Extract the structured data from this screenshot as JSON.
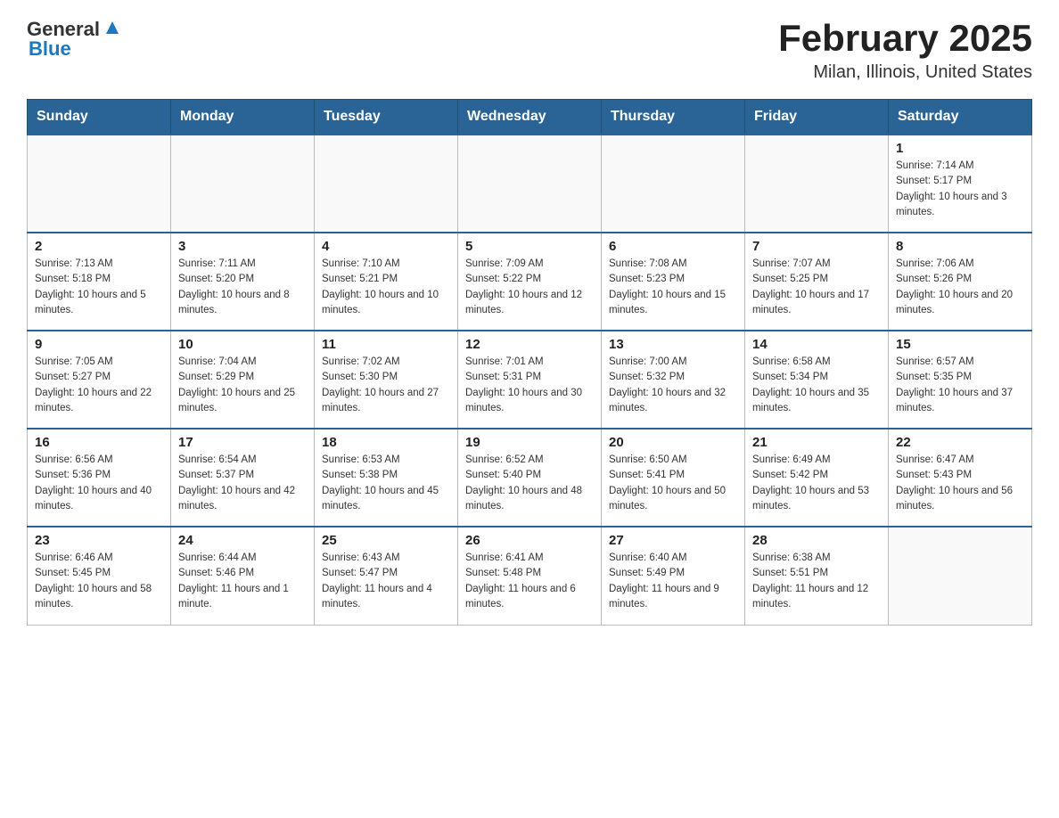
{
  "header": {
    "logo_general": "General",
    "logo_blue": "Blue",
    "month_title": "February 2025",
    "location": "Milan, Illinois, United States"
  },
  "days_of_week": [
    "Sunday",
    "Monday",
    "Tuesday",
    "Wednesday",
    "Thursday",
    "Friday",
    "Saturday"
  ],
  "weeks": [
    [
      {
        "day": "",
        "info": ""
      },
      {
        "day": "",
        "info": ""
      },
      {
        "day": "",
        "info": ""
      },
      {
        "day": "",
        "info": ""
      },
      {
        "day": "",
        "info": ""
      },
      {
        "day": "",
        "info": ""
      },
      {
        "day": "1",
        "info": "Sunrise: 7:14 AM\nSunset: 5:17 PM\nDaylight: 10 hours and 3 minutes."
      }
    ],
    [
      {
        "day": "2",
        "info": "Sunrise: 7:13 AM\nSunset: 5:18 PM\nDaylight: 10 hours and 5 minutes."
      },
      {
        "day": "3",
        "info": "Sunrise: 7:11 AM\nSunset: 5:20 PM\nDaylight: 10 hours and 8 minutes."
      },
      {
        "day": "4",
        "info": "Sunrise: 7:10 AM\nSunset: 5:21 PM\nDaylight: 10 hours and 10 minutes."
      },
      {
        "day": "5",
        "info": "Sunrise: 7:09 AM\nSunset: 5:22 PM\nDaylight: 10 hours and 12 minutes."
      },
      {
        "day": "6",
        "info": "Sunrise: 7:08 AM\nSunset: 5:23 PM\nDaylight: 10 hours and 15 minutes."
      },
      {
        "day": "7",
        "info": "Sunrise: 7:07 AM\nSunset: 5:25 PM\nDaylight: 10 hours and 17 minutes."
      },
      {
        "day": "8",
        "info": "Sunrise: 7:06 AM\nSunset: 5:26 PM\nDaylight: 10 hours and 20 minutes."
      }
    ],
    [
      {
        "day": "9",
        "info": "Sunrise: 7:05 AM\nSunset: 5:27 PM\nDaylight: 10 hours and 22 minutes."
      },
      {
        "day": "10",
        "info": "Sunrise: 7:04 AM\nSunset: 5:29 PM\nDaylight: 10 hours and 25 minutes."
      },
      {
        "day": "11",
        "info": "Sunrise: 7:02 AM\nSunset: 5:30 PM\nDaylight: 10 hours and 27 minutes."
      },
      {
        "day": "12",
        "info": "Sunrise: 7:01 AM\nSunset: 5:31 PM\nDaylight: 10 hours and 30 minutes."
      },
      {
        "day": "13",
        "info": "Sunrise: 7:00 AM\nSunset: 5:32 PM\nDaylight: 10 hours and 32 minutes."
      },
      {
        "day": "14",
        "info": "Sunrise: 6:58 AM\nSunset: 5:34 PM\nDaylight: 10 hours and 35 minutes."
      },
      {
        "day": "15",
        "info": "Sunrise: 6:57 AM\nSunset: 5:35 PM\nDaylight: 10 hours and 37 minutes."
      }
    ],
    [
      {
        "day": "16",
        "info": "Sunrise: 6:56 AM\nSunset: 5:36 PM\nDaylight: 10 hours and 40 minutes."
      },
      {
        "day": "17",
        "info": "Sunrise: 6:54 AM\nSunset: 5:37 PM\nDaylight: 10 hours and 42 minutes."
      },
      {
        "day": "18",
        "info": "Sunrise: 6:53 AM\nSunset: 5:38 PM\nDaylight: 10 hours and 45 minutes."
      },
      {
        "day": "19",
        "info": "Sunrise: 6:52 AM\nSunset: 5:40 PM\nDaylight: 10 hours and 48 minutes."
      },
      {
        "day": "20",
        "info": "Sunrise: 6:50 AM\nSunset: 5:41 PM\nDaylight: 10 hours and 50 minutes."
      },
      {
        "day": "21",
        "info": "Sunrise: 6:49 AM\nSunset: 5:42 PM\nDaylight: 10 hours and 53 minutes."
      },
      {
        "day": "22",
        "info": "Sunrise: 6:47 AM\nSunset: 5:43 PM\nDaylight: 10 hours and 56 minutes."
      }
    ],
    [
      {
        "day": "23",
        "info": "Sunrise: 6:46 AM\nSunset: 5:45 PM\nDaylight: 10 hours and 58 minutes."
      },
      {
        "day": "24",
        "info": "Sunrise: 6:44 AM\nSunset: 5:46 PM\nDaylight: 11 hours and 1 minute."
      },
      {
        "day": "25",
        "info": "Sunrise: 6:43 AM\nSunset: 5:47 PM\nDaylight: 11 hours and 4 minutes."
      },
      {
        "day": "26",
        "info": "Sunrise: 6:41 AM\nSunset: 5:48 PM\nDaylight: 11 hours and 6 minutes."
      },
      {
        "day": "27",
        "info": "Sunrise: 6:40 AM\nSunset: 5:49 PM\nDaylight: 11 hours and 9 minutes."
      },
      {
        "day": "28",
        "info": "Sunrise: 6:38 AM\nSunset: 5:51 PM\nDaylight: 11 hours and 12 minutes."
      },
      {
        "day": "",
        "info": ""
      }
    ]
  ]
}
